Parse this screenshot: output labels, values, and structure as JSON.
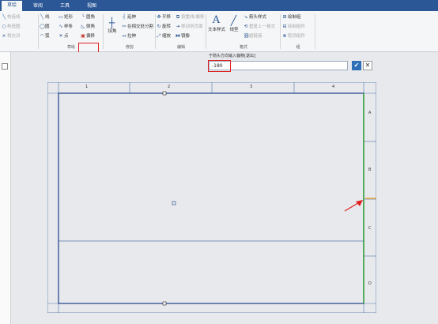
{
  "tabs": [
    "草绘",
    "审阅",
    "工具",
    "视图"
  ],
  "ribbon": {
    "setup": [
      "构造线",
      "构造圆",
      "相交对"
    ],
    "sketch_col1": [
      "线",
      "圆",
      "弧"
    ],
    "sketch_col2": [
      "矩形",
      "样条",
      "点"
    ],
    "sketch_col3": [
      "圆角",
      "倒角",
      "偏移"
    ],
    "sketch_group": "草绘",
    "modify_big": "拐角",
    "modify_items": [
      "延伸",
      "在相交处分割",
      "拉伸"
    ],
    "modify_group": "修剪",
    "edit_col1": [
      "平移",
      "旋转",
      "缩放"
    ],
    "edit_col2": [
      "按重线/偏移",
      "移动到页面",
      "镜像"
    ],
    "edit_group": "编辑",
    "text_style": "文本样式",
    "line_style": "线型",
    "format_items": [
      "箭头样式",
      "重复上一格式",
      "超链接"
    ],
    "format_group": "格式",
    "group_items": [
      "绘制组",
      "绘制组件",
      "取消组件"
    ],
    "group_group": "组"
  },
  "prompt": {
    "label": "于箭头方向输入偏移[退出]",
    "value": "-180",
    "ok": "✔",
    "cancel": "✕"
  },
  "sheet": {
    "col_labels": [
      "1",
      "2",
      "3",
      "4"
    ],
    "row_labels": [
      "A",
      "B",
      "C",
      "D"
    ]
  },
  "colors": {
    "sheet_border": "#1f3f8a",
    "zone_line": "#5577aa",
    "selected_edge": "#2aa02a",
    "drag_arrow": "#f0a020",
    "callout": "#e02020"
  }
}
